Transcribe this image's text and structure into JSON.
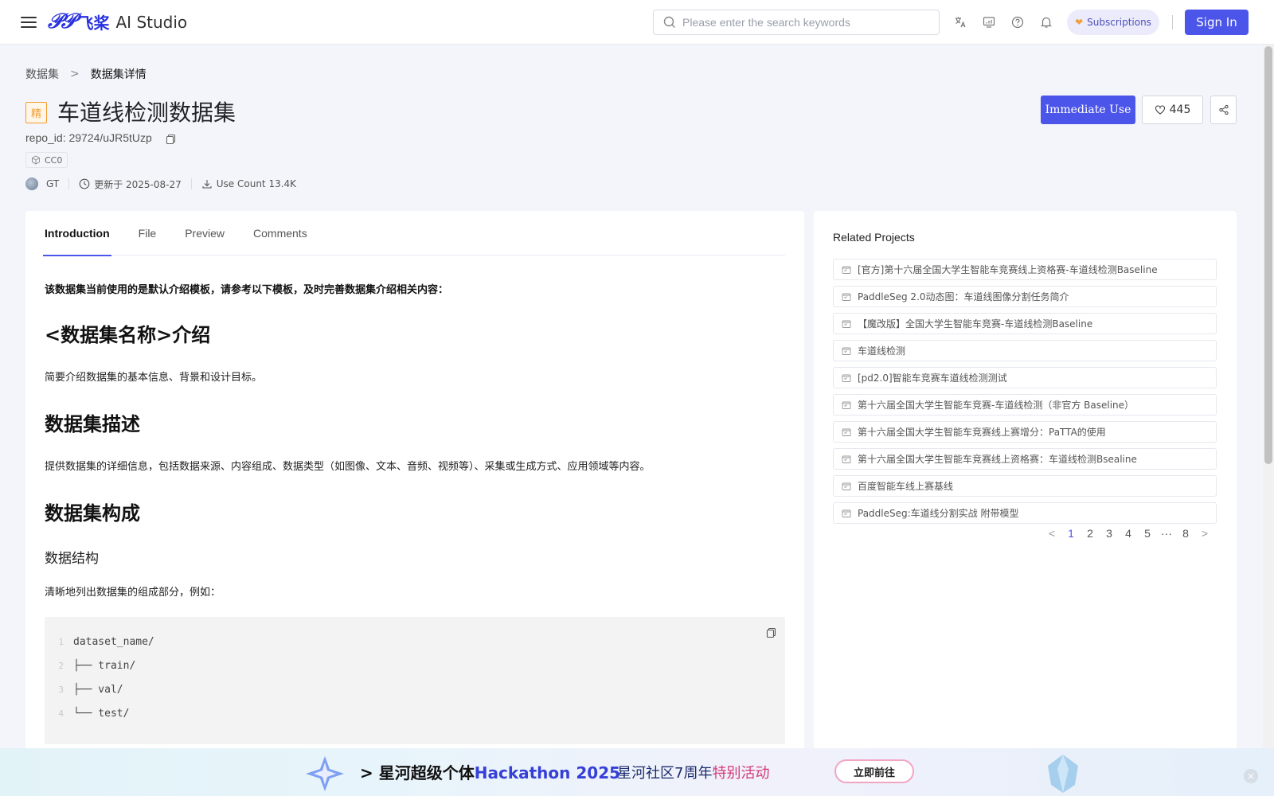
{
  "header": {
    "logo_mark": "𝒫𝒫",
    "logo_cn": "飞桨",
    "logo_en": "AI Studio",
    "search_placeholder": "Please enter the search keywords",
    "subscriptions_label": "Subscriptions",
    "signin_label": "Sign In"
  },
  "breadcrumb": {
    "parent": "数据集",
    "separator": ">",
    "current": "数据集详情"
  },
  "dataset": {
    "badge": "精",
    "title": "车道线检测数据集",
    "repo_id": "repo_id: 29724/uJR5tUzp",
    "license": "CC0",
    "author": "GT",
    "updated": "更新于 2025-08-27",
    "use_count": "Use Count 13.4K",
    "like_count": "445",
    "immediate_use_label": "Immediate Use"
  },
  "tabs": [
    {
      "label": "Introduction"
    },
    {
      "label": "File"
    },
    {
      "label": "Preview"
    },
    {
      "label": "Comments"
    }
  ],
  "content": {
    "note": "该数据集当前使用的是默认介绍模板，请参考以下模板，及时完善数据集介绍相关内容：",
    "h_intro": "<数据集名称>介绍",
    "p_intro": "简要介绍数据集的基本信息、背景和设计目标。",
    "h_desc": "数据集描述",
    "p_desc": "提供数据集的详细信息，包括数据来源、内容组成、数据类型（如图像、文本、音频、视频等）、采集或生成方式、应用领域等内容。",
    "h_comp": "数据集构成",
    "h_struct": "数据结构",
    "p_struct": "清晰地列出数据集的组成部分，例如：",
    "code_lines": [
      {
        "num": "1",
        "text": "dataset_name/"
      },
      {
        "num": "2",
        "text": "├── train/"
      },
      {
        "num": "3",
        "text": "├── val/"
      },
      {
        "num": "4",
        "text": "└── test/"
      }
    ]
  },
  "related": {
    "title": "Related Projects",
    "items": [
      "[官方]第十六届全国大学生智能车竞赛线上资格赛-车道线检测Baseline",
      "PaddleSeg 2.0动态图：车道线图像分割任务简介",
      "【魔改版】全国大学生智能车竞赛-车道线检测Baseline",
      "车道线检测",
      "[pd2.0]智能车竞赛车道线检测测试",
      "第十六届全国大学生智能车竞赛-车道线检测（非官方 Baseline）",
      "第十六届全国大学生智能车竞赛线上赛增分：PaTTA的使用",
      "第十六届全国大学生智能车竞赛线上资格赛：车道线检测Bsealine",
      "百度智能车线上赛基线",
      "PaddleSeg:车道线分割实战 附带模型"
    ],
    "pages": [
      "1",
      "2",
      "3",
      "4",
      "5",
      "···",
      "8"
    ],
    "current_page": "1",
    "prev_arrow": "<",
    "next_arrow": ">"
  },
  "banner": {
    "arrow": ">",
    "text_a": "星河超级个体",
    "text_b": "Hackathon 2025",
    "sub_a": "星河社区7周年",
    "sub_b": "特别活动",
    "button": "立即前往",
    "close": "×"
  },
  "colors": {
    "accent": "#4b55e9",
    "badge_orange": "#f39b2d",
    "page_bg": "#f4f5fa"
  }
}
